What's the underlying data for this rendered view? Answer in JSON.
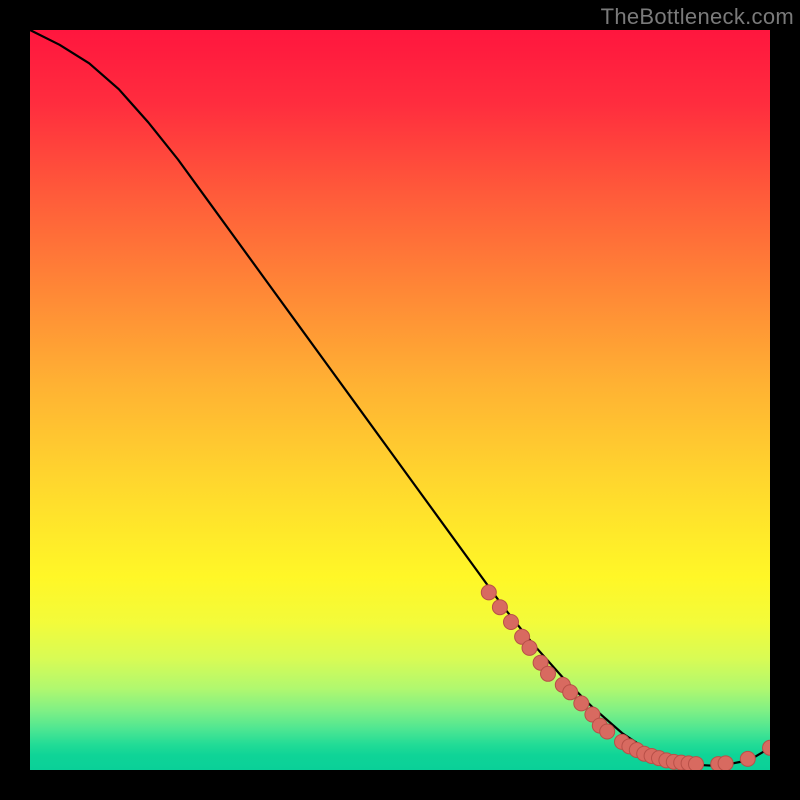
{
  "watermark": "TheBottleneck.com",
  "colors": {
    "curve": "#000000",
    "dot_fill": "#d86a60",
    "dot_stroke": "#b85048",
    "background": "#000000"
  },
  "chart_data": {
    "type": "line",
    "title": "",
    "xlabel": "",
    "ylabel": "",
    "xlim": [
      0,
      100
    ],
    "ylim": [
      0,
      100
    ],
    "grid": false,
    "legend": false,
    "series": [
      {
        "name": "bottleneck-curve",
        "x": [
          0,
          4,
          8,
          12,
          16,
          20,
          24,
          28,
          32,
          36,
          40,
          44,
          48,
          52,
          56,
          60,
          64,
          68,
          72,
          76,
          80,
          83,
          86,
          88,
          90,
          92,
          94,
          96,
          98,
          100
        ],
        "y": [
          100,
          98,
          95.5,
          92,
          87.5,
          82.5,
          77,
          71.5,
          66,
          60.5,
          55,
          49.5,
          44,
          38.5,
          33,
          27.5,
          22,
          17,
          12.5,
          8.5,
          5,
          3,
          1.6,
          1.0,
          0.7,
          0.6,
          0.7,
          1.1,
          1.8,
          3.0
        ]
      }
    ],
    "points": [
      {
        "name": "dot",
        "x": 62,
        "y": 24
      },
      {
        "name": "dot",
        "x": 63.5,
        "y": 22
      },
      {
        "name": "dot",
        "x": 65,
        "y": 20
      },
      {
        "name": "dot",
        "x": 66.5,
        "y": 18
      },
      {
        "name": "dot",
        "x": 67.5,
        "y": 16.5
      },
      {
        "name": "dot",
        "x": 69,
        "y": 14.5
      },
      {
        "name": "dot",
        "x": 70,
        "y": 13
      },
      {
        "name": "dot",
        "x": 72,
        "y": 11.5
      },
      {
        "name": "dot",
        "x": 73,
        "y": 10.5
      },
      {
        "name": "dot",
        "x": 74.5,
        "y": 9.0
      },
      {
        "name": "dot",
        "x": 76,
        "y": 7.5
      },
      {
        "name": "dot",
        "x": 77,
        "y": 6.0
      },
      {
        "name": "dot",
        "x": 78,
        "y": 5.2
      },
      {
        "name": "dot",
        "x": 80,
        "y": 3.8
      },
      {
        "name": "dot",
        "x": 81,
        "y": 3.2
      },
      {
        "name": "dot",
        "x": 82,
        "y": 2.7
      },
      {
        "name": "dot",
        "x": 83,
        "y": 2.2
      },
      {
        "name": "dot",
        "x": 84,
        "y": 1.9
      },
      {
        "name": "dot",
        "x": 85,
        "y": 1.6
      },
      {
        "name": "dot",
        "x": 86,
        "y": 1.3
      },
      {
        "name": "dot",
        "x": 87,
        "y": 1.1
      },
      {
        "name": "dot",
        "x": 88,
        "y": 1.0
      },
      {
        "name": "dot",
        "x": 89,
        "y": 0.9
      },
      {
        "name": "dot",
        "x": 90,
        "y": 0.8
      },
      {
        "name": "dot",
        "x": 93,
        "y": 0.8
      },
      {
        "name": "dot",
        "x": 94,
        "y": 0.9
      },
      {
        "name": "dot",
        "x": 97,
        "y": 1.5
      },
      {
        "name": "dot",
        "x": 100,
        "y": 3.0
      }
    ]
  }
}
